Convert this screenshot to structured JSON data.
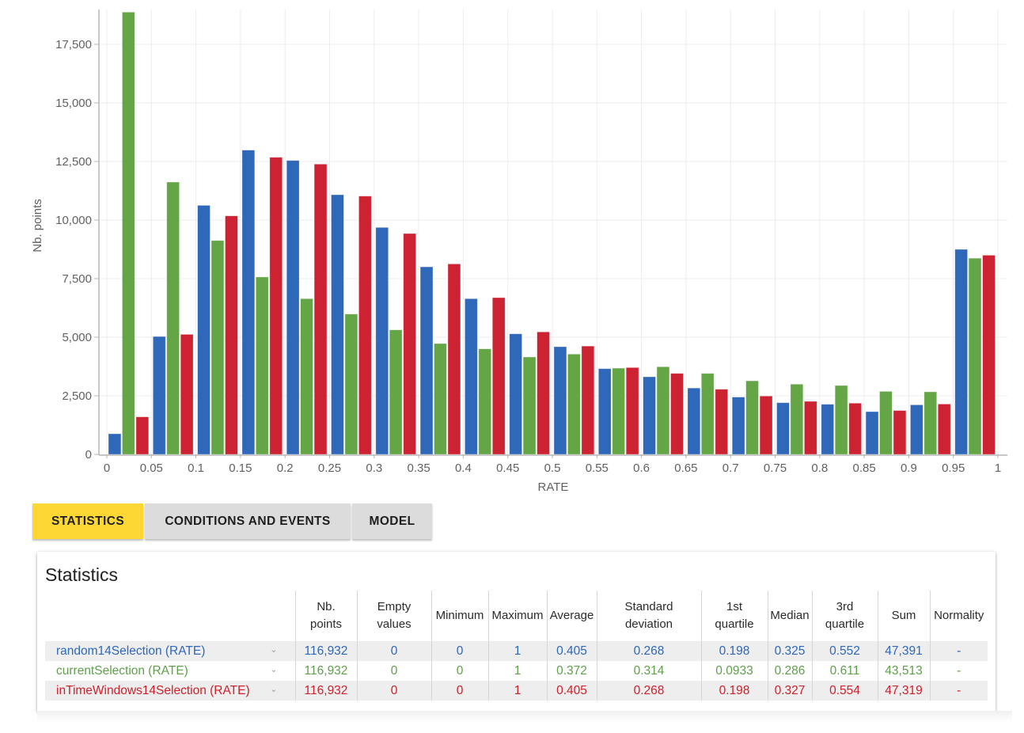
{
  "chart_data": {
    "type": "bar",
    "title": "",
    "xlabel": "RATE",
    "ylabel": "Nb. points",
    "xlim": [
      0,
      1
    ],
    "ylim": [
      0,
      19000
    ],
    "grid": true,
    "legend": "none",
    "bin_width": 0.05,
    "x_ticks": [
      "0",
      "0.05",
      "0.1",
      "0.15",
      "0.2",
      "0.25",
      "0.3",
      "0.35",
      "0.4",
      "0.45",
      "0.5",
      "0.55",
      "0.6",
      "0.65",
      "0.7",
      "0.75",
      "0.8",
      "0.85",
      "0.9",
      "0.95",
      "1"
    ],
    "y_ticks": [
      0,
      2500,
      5000,
      7500,
      10000,
      12500,
      15000,
      17500
    ],
    "y_tick_labels": [
      "0",
      "2,500",
      "5,000",
      "7,500",
      "10,000",
      "12,500",
      "15,000",
      "17,500"
    ],
    "categories": [
      "0-0.05",
      "0.05-0.1",
      "0.1-0.15",
      "0.15-0.2",
      "0.2-0.25",
      "0.25-0.3",
      "0.3-0.35",
      "0.35-0.4",
      "0.4-0.45",
      "0.45-0.5",
      "0.5-0.55",
      "0.55-0.6",
      "0.6-0.65",
      "0.65-0.7",
      "0.7-0.75",
      "0.75-0.8",
      "0.8-0.85",
      "0.85-0.9",
      "0.9-0.95",
      "0.95-1"
    ],
    "series": [
      {
        "name": "random14Selection (RATE)",
        "color": "#2f67b9",
        "values": [
          880,
          5030,
          10630,
          12985,
          12545,
          11080,
          9685,
          8005,
          6645,
          5145,
          4595,
          3660,
          3310,
          2830,
          2445,
          2205,
          2140,
          1825,
          2115,
          8750
        ]
      },
      {
        "name": "currentSelection (RATE)",
        "color": "#64a546",
        "values": [
          18875,
          11620,
          9130,
          7570,
          6645,
          5990,
          5315,
          4730,
          4505,
          4155,
          4280,
          3680,
          3740,
          3455,
          3140,
          2995,
          2940,
          2690,
          2670,
          8370
        ]
      },
      {
        "name": "inTimeWindows14Selection (RATE)",
        "color": "#cc2231",
        "values": [
          1600,
          5120,
          10180,
          12680,
          12390,
          11025,
          9425,
          8130,
          6690,
          5225,
          4620,
          3705,
          3455,
          2780,
          2490,
          2265,
          2185,
          1870,
          2150,
          8500
        ]
      }
    ]
  },
  "tabs": [
    {
      "label": "STATISTICS",
      "active": true
    },
    {
      "label": "CONDITIONS AND EVENTS",
      "active": false
    },
    {
      "label": "MODEL",
      "active": false
    }
  ],
  "statistics": {
    "title": "Statistics",
    "columns": [
      "",
      "Nb.\npoints",
      "Empty\nvalues",
      "Minimum",
      "Maximum",
      "Average",
      "Standard\ndeviation",
      "1st\nquartile",
      "Median",
      "3rd\nquartile",
      "Sum",
      "Normality"
    ],
    "rows": [
      {
        "name": "random14Selection (RATE)",
        "chevron": "⌄",
        "nb_points": "116,932",
        "empty": "0",
        "min": "0",
        "max": "1",
        "avg": "0.405",
        "std": "0.268",
        "q1": "0.198",
        "median": "0.325",
        "q3": "0.552",
        "sum": "47,391",
        "normality": "-"
      },
      {
        "name": "currentSelection (RATE)",
        "chevron": "⌄",
        "nb_points": "116,932",
        "empty": "0",
        "min": "0",
        "max": "1",
        "avg": "0.372",
        "std": "0.314",
        "q1": "0.0933",
        "median": "0.286",
        "q3": "0.611",
        "sum": "43,513",
        "normality": "-"
      },
      {
        "name": "inTimeWindows14Selection (RATE)",
        "chevron": "⌄",
        "nb_points": "116,932",
        "empty": "0",
        "min": "0",
        "max": "1",
        "avg": "0.405",
        "std": "0.268",
        "q1": "0.198",
        "median": "0.327",
        "q3": "0.554",
        "sum": "47,319",
        "normality": "-"
      }
    ]
  }
}
